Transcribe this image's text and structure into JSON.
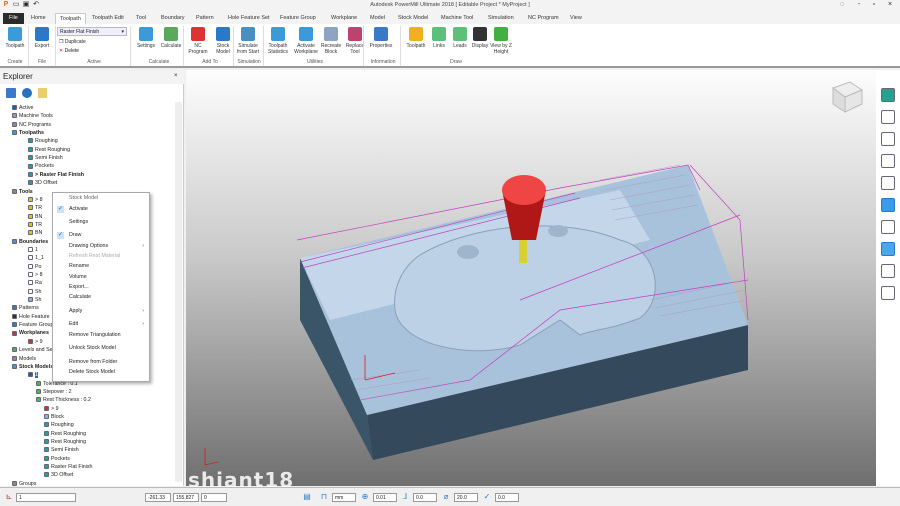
{
  "window": {
    "title": "Autodesk PowerMill Ultimate 2018   [ Editable Project * MyProject ]"
  },
  "tabs": [
    "File",
    "Home",
    "Toolpath",
    "Toolpath Edit",
    "Tool",
    "Boundary",
    "Pattern",
    "Hole Feature Set",
    "Feature Group",
    "Workplane",
    "Model",
    "Stock Model",
    "Machine Tool",
    "Simulation",
    "NC Program",
    "View"
  ],
  "ribbon": {
    "active_toolpath": "Raster Flat Finish",
    "duplicate": "Duplicate",
    "delete": "Delete",
    "buttons": [
      {
        "label": "Toolpath",
        "color": "#3a9bd8"
      },
      {
        "label": "Export",
        "color": "#2a78c8"
      },
      {
        "label": "Settings",
        "color": "#3a9bd8"
      },
      {
        "label": "Calculate",
        "color": "#5aa85a"
      },
      {
        "label": "NC Program",
        "color": "#d33"
      },
      {
        "label": "Stock Model",
        "color": "#2a78c8"
      },
      {
        "label": "Simulate from Start",
        "color": "#4a8fc0"
      },
      {
        "label": "Toolpath Statistics",
        "color": "#3a9bd8"
      },
      {
        "label": "Activate Workplane",
        "color": "#3a9bd8"
      },
      {
        "label": "Recreate Block",
        "color": "#8fa4c0"
      },
      {
        "label": "Replace Tool",
        "color": "#c04070"
      },
      {
        "label": "Properties",
        "color": "#3a78c8"
      },
      {
        "label": "Toolpath",
        "color": "#f0b020"
      },
      {
        "label": "Links",
        "color": "#5cc07a"
      },
      {
        "label": "Leads",
        "color": "#5cc07a"
      },
      {
        "label": "Display",
        "color": "#333"
      },
      {
        "label": "View by Z Height",
        "color": "#40b040"
      }
    ],
    "groups": [
      "Create",
      "File",
      "Active",
      "Calculate",
      "Add To",
      "Simulation",
      "Utilities",
      "Information",
      "Draw"
    ]
  },
  "explorer": {
    "title": "Explorer",
    "tree": [
      {
        "label": "Active",
        "c": "#1a5fb4"
      },
      {
        "label": "Machine Tools",
        "c": "#999"
      },
      {
        "label": "NC Programs",
        "c": "#889"
      },
      {
        "label": "Toolpaths",
        "c": "#3a9bd8",
        "b": true
      },
      {
        "label": "Roughing",
        "c": "#1ba39c"
      },
      {
        "label": "Rest Roughing",
        "c": "#1ba39c"
      },
      {
        "label": "Semi Finish",
        "c": "#1ba39c"
      },
      {
        "label": "Pockets",
        "c": "#1ba39c"
      },
      {
        "label": "> Raster Flat Finish",
        "c": "#1ba39c",
        "b": true
      },
      {
        "label": "3D Offset",
        "c": "#1ba39c"
      },
      {
        "label": "Tools",
        "c": "#888",
        "b": true
      },
      {
        "label": "> 8",
        "c": "#e0c020"
      },
      {
        "label": "TR",
        "c": "#e0c020"
      },
      {
        "label": "BN",
        "c": "#e0c020"
      },
      {
        "label": "TR",
        "c": "#e0c020"
      },
      {
        "label": "BN",
        "c": "#e0c020"
      },
      {
        "label": "Boundaries",
        "c": "#5a8ad0",
        "b": true
      },
      {
        "label": "1",
        "c": "#fff"
      },
      {
        "label": "1_1",
        "c": "#fff"
      },
      {
        "label": "Po",
        "c": "#fff"
      },
      {
        "label": "> 8",
        "c": "#fff"
      },
      {
        "label": "Ra",
        "c": "#fff"
      },
      {
        "label": "Sh",
        "c": "#fff"
      },
      {
        "label": "Sh",
        "c": "#9ac"
      },
      {
        "label": "Patterns",
        "c": "#3a78c8"
      },
      {
        "label": "Hole Feature",
        "c": "#333"
      },
      {
        "label": "Feature Group",
        "c": "#3a78c8"
      },
      {
        "label": "Workplanes",
        "c": "#c33",
        "b": true
      },
      {
        "label": "> 9",
        "c": "#c33"
      },
      {
        "label": "Levels and Se",
        "c": "#5a5"
      },
      {
        "label": "Models",
        "c": "#889"
      },
      {
        "label": "Stock Models",
        "c": "#3a9bd8",
        "b": true
      },
      {
        "label": "1",
        "c": "#1a5fb4"
      },
      {
        "label": "Tolerance : 0.1",
        "c": "#3c3"
      },
      {
        "label": "Stepover : 2",
        "c": "#3c3"
      },
      {
        "label": "Rest Thickness : 0.2",
        "c": "#3c3"
      },
      {
        "label": "> 9",
        "c": "#c33"
      },
      {
        "label": "Block",
        "c": "#8ab4e0"
      },
      {
        "label": "Roughing",
        "c": "#1ba39c"
      },
      {
        "label": "Rest Roughing",
        "c": "#1ba39c"
      },
      {
        "label": "Rest Roughing",
        "c": "#1ba39c"
      },
      {
        "label": "Semi Finish",
        "c": "#1ba39c"
      },
      {
        "label": "Pockets",
        "c": "#1ba39c"
      },
      {
        "label": "Raster Flat Finish",
        "c": "#1ba39c"
      },
      {
        "label": "3D Offset",
        "c": "#1ba39c"
      },
      {
        "label": "Groups",
        "c": "#888"
      }
    ]
  },
  "context_menu": {
    "header": "Stock Model",
    "items": [
      {
        "label": "Activate",
        "check": true
      },
      {
        "label": "Settings"
      },
      {
        "label": "Draw",
        "check": true
      },
      {
        "label": "Drawing Options",
        "sub": true
      },
      {
        "label": "Refresh Rest Material",
        "disabled": true
      },
      {
        "label": "Rename"
      },
      {
        "label": "Volume"
      },
      {
        "label": "Export..."
      },
      {
        "label": "Calculate"
      },
      {
        "label": "Apply",
        "sub": true
      },
      {
        "label": "Edit",
        "sub": true
      },
      {
        "label": "Remove Triangulation"
      },
      {
        "label": "Unlock Stock Model"
      },
      {
        "label": "Remove from Folder"
      },
      {
        "label": "Delete Stock Model"
      }
    ]
  },
  "status": {
    "workplane": "1",
    "x": "-261.33",
    "y": "155.827",
    "z": "0",
    "units": "mm",
    "tolerance": "0.01",
    "thickness": "0.0",
    "diameter": "20.0",
    "angle": "0.0"
  },
  "watermark": "shiant18"
}
